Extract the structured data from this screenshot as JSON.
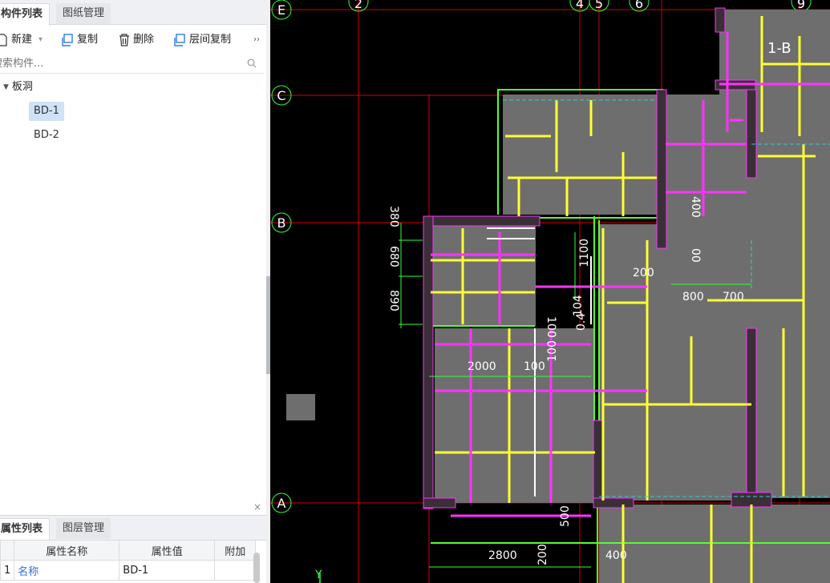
{
  "top_panel": {
    "tabs": [
      {
        "label": "构件列表",
        "active": true
      },
      {
        "label": "图纸管理",
        "active": false
      }
    ],
    "toolbar": {
      "new_label": "新建",
      "copy_label": "复制",
      "delete_label": "删除",
      "floor_copy_label": "层间复制",
      "more_label": "››"
    },
    "search": {
      "placeholder": "搜索构件..."
    },
    "tree": {
      "root_label": "板洞",
      "items": [
        "BD-1",
        "BD-2"
      ],
      "selected": "BD-1"
    }
  },
  "bottom_panel": {
    "tabs": [
      {
        "label": "属性列表",
        "active": true
      },
      {
        "label": "图层管理",
        "active": false
      }
    ],
    "close_label": "×",
    "table": {
      "headers": [
        "属性名称",
        "属性值",
        "附加"
      ],
      "rows": [
        {
          "index": "1",
          "name": "名称",
          "value": "BD-1",
          "extra": ""
        }
      ]
    }
  },
  "cad": {
    "axis_labels_top": [
      "E",
      "2",
      "4",
      "5",
      "6",
      "9"
    ],
    "axis_labels_left": [
      "C",
      "B",
      "A"
    ],
    "room_label": "1-B",
    "ucs_label": "Y",
    "dimensions": [
      "380",
      "680",
      "890",
      "1100",
      "200",
      "400",
      "00",
      "800",
      "700",
      "104",
      "0.4",
      "100",
      "100",
      "2000",
      "100",
      "500",
      "2800",
      "200",
      "400"
    ],
    "colors": {
      "background": "#000000",
      "axis": "#d40000",
      "wall": "#ffff33",
      "beam": "#ff33ff",
      "outline": "#55ff33",
      "slab": "#6e6e6e",
      "dim": "#33ff33"
    }
  }
}
